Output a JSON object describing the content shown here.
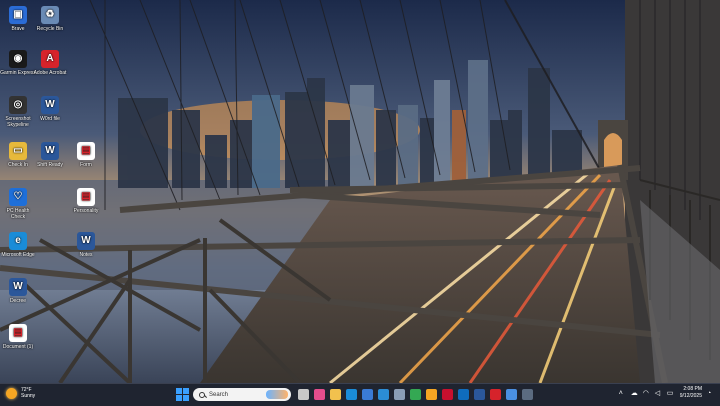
{
  "desktop_icons": [
    {
      "label": "Brave",
      "icon": "brave-icon",
      "color": "#2b6cd6",
      "glyph": "▣"
    },
    {
      "label": "Recycle Bin",
      "icon": "recycle-bin-icon",
      "color": "#6a8bb5",
      "glyph": "♻"
    },
    {
      "label": "Garmin Express",
      "icon": "garmin-icon",
      "color": "#1a1a1a",
      "glyph": "◉"
    },
    {
      "label": "Adobe Acrobat",
      "icon": "acrobat-icon",
      "color": "#d6232b",
      "glyph": "A"
    },
    {
      "label": "Screenshot Skypeline",
      "icon": "screenshot-icon",
      "color": "#333333",
      "glyph": "◎"
    },
    {
      "label": "W0rd file",
      "icon": "word-doc-icon",
      "color": "#2b579a",
      "glyph": "W"
    },
    {
      "label": "Check In",
      "icon": "folder-icon",
      "color": "#e7b93b",
      "glyph": "▭"
    },
    {
      "label": "Shift Ready",
      "icon": "word-doc-icon",
      "color": "#2b579a",
      "glyph": "W"
    },
    {
      "label": "Form",
      "icon": "pdf-icon",
      "color": "#ffffff",
      "glyph": "▤"
    },
    {
      "label": "PC Health Check",
      "icon": "pc-health-icon",
      "color": "#1e6fd9",
      "glyph": "♡"
    },
    {
      "label": "Personality",
      "icon": "pdf-icon",
      "color": "#ffffff",
      "glyph": "▤"
    },
    {
      "label": "Microsoft Edge",
      "icon": "edge-icon",
      "color": "#1a8cd8",
      "glyph": "e"
    },
    {
      "label": "Notes",
      "icon": "word-doc-icon",
      "color": "#2b579a",
      "glyph": "W"
    },
    {
      "label": "Decree",
      "icon": "word-doc-icon",
      "color": "#2b579a",
      "glyph": "W"
    },
    {
      "label": "Document (1)",
      "icon": "pdf-icon",
      "color": "#ffffff",
      "glyph": "▤"
    }
  ],
  "taskbar": {
    "weather_temp": "72°F",
    "weather_desc": "Sunny",
    "search_placeholder": "Search",
    "apps": [
      {
        "name": "task-view-icon",
        "color": "#c8c8c8"
      },
      {
        "name": "widgets-icon",
        "color": "#e44d8c"
      },
      {
        "name": "file-explorer-icon",
        "color": "#f2c14e"
      },
      {
        "name": "edge-icon",
        "color": "#1a8cd8"
      },
      {
        "name": "store-icon",
        "color": "#3a7bd5"
      },
      {
        "name": "mail-icon",
        "color": "#2b8dd6"
      },
      {
        "name": "settings-icon",
        "color": "#8a9db5"
      },
      {
        "name": "chrome-icon",
        "color": "#34a853"
      },
      {
        "name": "weather-app-icon",
        "color": "#f5a623"
      },
      {
        "name": "mcafee-icon",
        "color": "#c8102e"
      },
      {
        "name": "outlook-icon",
        "color": "#0f6cbd"
      },
      {
        "name": "word-icon",
        "color": "#2b579a"
      },
      {
        "name": "acrobat-icon",
        "color": "#d6232b"
      },
      {
        "name": "photos-icon",
        "color": "#4a90e2"
      },
      {
        "name": "calendar-icon",
        "color": "#5b6b80"
      }
    ],
    "time": "2:08 PM",
    "date": "9/12/2025"
  }
}
